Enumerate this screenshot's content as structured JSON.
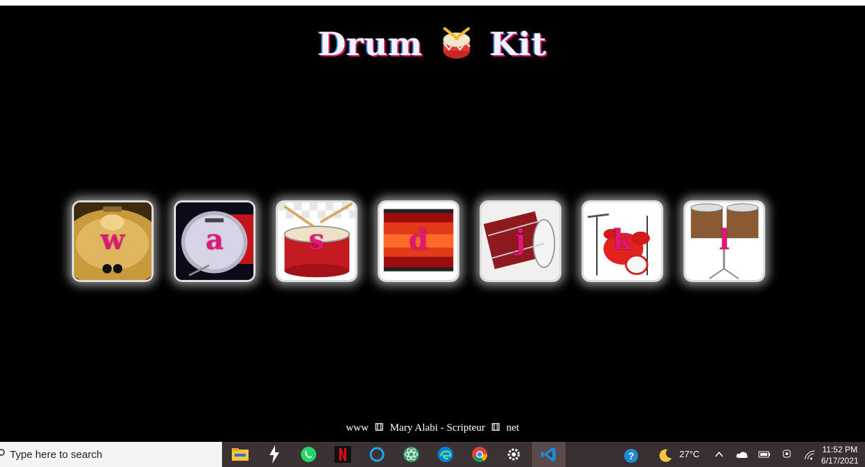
{
  "page": {
    "title_left": "Drum",
    "title_right": "Kit",
    "footer": {
      "part1": "www",
      "part2": "Mary Alabi - Scripteur",
      "part3": "net"
    }
  },
  "keys": [
    {
      "letter": "w",
      "image": "cymbal-icon"
    },
    {
      "letter": "a",
      "image": "bass-drum-icon"
    },
    {
      "letter": "s",
      "image": "snare-drum-icon"
    },
    {
      "letter": "d",
      "image": "red-drum-icon"
    },
    {
      "letter": "j",
      "image": "floor-tom-icon"
    },
    {
      "letter": "k",
      "image": "drum-set-icon"
    },
    {
      "letter": "l",
      "image": "tom-toms-icon"
    }
  ],
  "taskbar": {
    "search_placeholder": "Type here to search",
    "weather_temp": "27°C",
    "time": "11:52 PM",
    "date": "6/17/2021",
    "apps": [
      "file-explorer-icon",
      "lightning-app-icon",
      "whatsapp-icon",
      "netflix-icon",
      "cortana-icon",
      "atom-icon",
      "edge-icon",
      "chrome-icon",
      "settings-icon",
      "vscode-icon"
    ]
  },
  "colors": {
    "background": "#000000",
    "key_letter": "#e01679",
    "title_shadow": "#d81466"
  }
}
